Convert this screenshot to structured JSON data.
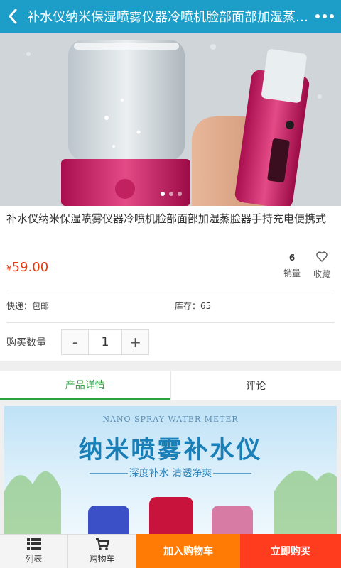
{
  "header": {
    "title": "补水仪纳米保湿喷雾仪器冷喷机脸部面部加湿蒸脸器手持充电便携式",
    "back_icon": "chevron-left-icon",
    "more_icon": "more-dots-icon"
  },
  "carousel": {
    "total": 3,
    "active": 1
  },
  "product": {
    "name": "补水仪纳米保湿喷雾仪器冷喷机脸部面部加湿蒸脸器手持充电便携式",
    "currency": "¥",
    "price": "59.00",
    "sales_count": "6",
    "sales_label": "销量",
    "favorite_label": "收藏",
    "shipping": "快递：包邮",
    "stock": "库存：65"
  },
  "quantity": {
    "label": "购买数量",
    "minus": "-",
    "value": "1",
    "plus": "+"
  },
  "tabs": [
    {
      "label": "产品详情",
      "active": true
    },
    {
      "label": "评论",
      "active": false
    }
  ],
  "banner": {
    "en": "NANO SPRAY WATER METER",
    "zh": "纳米喷雾补水仪",
    "sub": "深度补水  清透净爽"
  },
  "bottom_bar": {
    "list_label": "列表",
    "cart_label": "购物车",
    "add_to_cart": "加入购物车",
    "buy_now": "立即购买"
  },
  "colors": {
    "header": "#1c9ec9",
    "price": "#e8380d",
    "active_tab": "#2ca23f",
    "cart_button": "#ff7b06",
    "buy_button": "#ff3c1d"
  }
}
